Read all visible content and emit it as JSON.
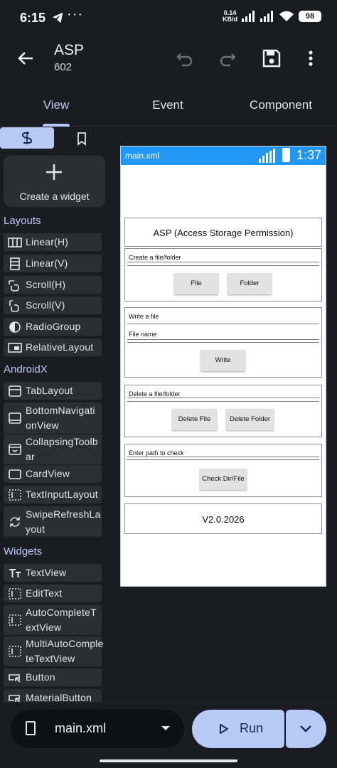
{
  "status_bar": {
    "time": "6:15",
    "net_speed_value": "0.14",
    "net_speed_unit": "KB/d",
    "battery": "98"
  },
  "appbar": {
    "title": "ASP",
    "subtitle": "602"
  },
  "tabs": [
    {
      "label": "View"
    },
    {
      "label": "Event"
    },
    {
      "label": "Component"
    }
  ],
  "palette": {
    "create_label": "Create a widget",
    "sections": {
      "layouts": "Layouts",
      "androidx": "AndroidX",
      "widgets": "Widgets"
    },
    "layouts": [
      "Linear(H)",
      "Linear(V)",
      "Scroll(H)",
      "Scroll(V)",
      "RadioGroup",
      "RelativeLayout"
    ],
    "androidx": [
      "TabLayout",
      "BottomNavigati",
      "onView",
      "CollapsingToolb",
      "ar",
      "CardView",
      "TextInputLayout",
      "SwipeRefreshLa",
      "yout"
    ],
    "widgets": [
      "TextView",
      "EditText",
      "AutoCompleteT",
      "extView",
      "MultiAutoComple",
      "teTextView",
      "Button",
      "MaterialButton"
    ]
  },
  "preview": {
    "file": "main.xml",
    "time": "1:37",
    "title": "ASP (Access Storage Permission)",
    "create_label": "Create a file/folder",
    "file_button": "File",
    "folder_button": "Folder",
    "write_label": "Write a file",
    "file_name_label": "File name",
    "write_button": "Write",
    "delete_label": "Delete a file/folder",
    "delete_file_button": "Delete File",
    "delete_folder_button": "Delete Folder",
    "path_label": "Enter path to check",
    "check_button": "Check Dir/File",
    "version": "V2.0.2026"
  },
  "bottom": {
    "file": "main.xml",
    "run": "Run"
  },
  "colors": {
    "accent": "#b7c9f5",
    "background": "#1b1c21",
    "preview_bar": "#2196f3"
  }
}
